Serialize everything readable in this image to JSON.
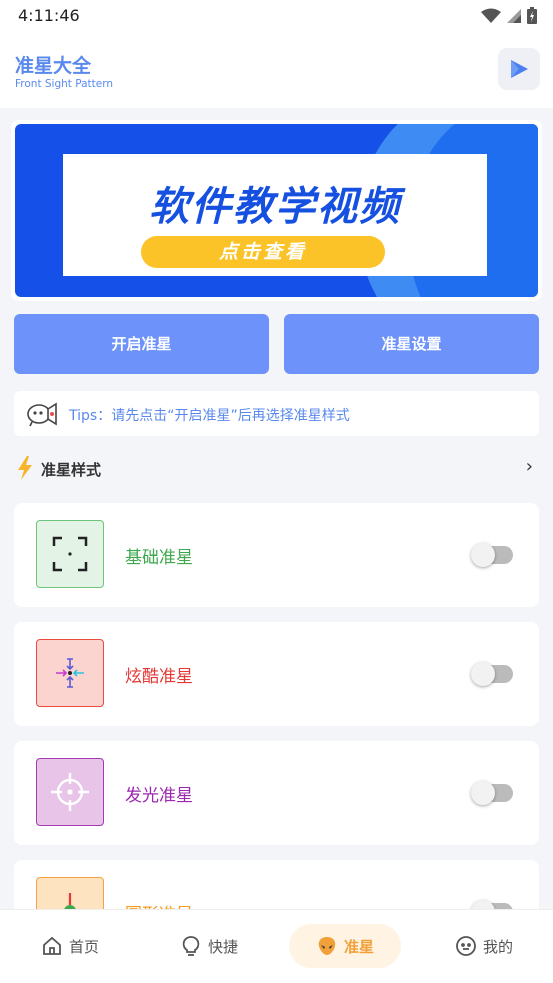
{
  "status_bar": {
    "time": "4:11:46"
  },
  "header": {
    "title": "准星大全",
    "subtitle": "Front Sight Pattern",
    "play_icon": "play-icon",
    "accent": "#5a89ee"
  },
  "banner": {
    "title": "软件教学视频",
    "button": "点击查看",
    "colors": {
      "background": "#1550e8",
      "button": "#fbc327"
    }
  },
  "actions": {
    "open": "开启准星",
    "settings": "准星设置",
    "color": "#6d93fb"
  },
  "tips": {
    "text": "Tips：请先点击“开启准星”后再选择准星样式",
    "icon": "megaphone-icon"
  },
  "section": {
    "icon": "lightning-icon",
    "title": "准星样式",
    "more": "›"
  },
  "styles": [
    {
      "name": "基础准星",
      "color": "#3fa84e",
      "thumb_bg": "#e3f3e6",
      "thumb_border": "#6cc37c",
      "icon": "bracket-crosshair-icon",
      "enabled": false
    },
    {
      "name": "炫酷准星",
      "color": "#e53935",
      "thumb_bg": "#fbd4cf",
      "thumb_border": "#ea4c3f",
      "icon": "arrow-crosshair-icon",
      "enabled": false
    },
    {
      "name": "发光准星",
      "color": "#9c27b0",
      "thumb_bg": "#e7c4e8",
      "thumb_border": "#a33aaf",
      "icon": "glow-crosshair-icon",
      "enabled": false
    },
    {
      "name": "圆形准星",
      "color": "#f29b1c",
      "thumb_bg": "#fde3c0",
      "thumb_border": "#f3a245",
      "icon": "circle-crosshair-icon",
      "enabled": false
    }
  ],
  "nav": [
    {
      "label": "首页",
      "icon": "home-icon",
      "active": false
    },
    {
      "label": "快捷",
      "icon": "lightbulb-icon",
      "active": false
    },
    {
      "label": "准星",
      "icon": "alien-icon",
      "active": true
    },
    {
      "label": "我的",
      "icon": "face-icon",
      "active": false
    }
  ]
}
